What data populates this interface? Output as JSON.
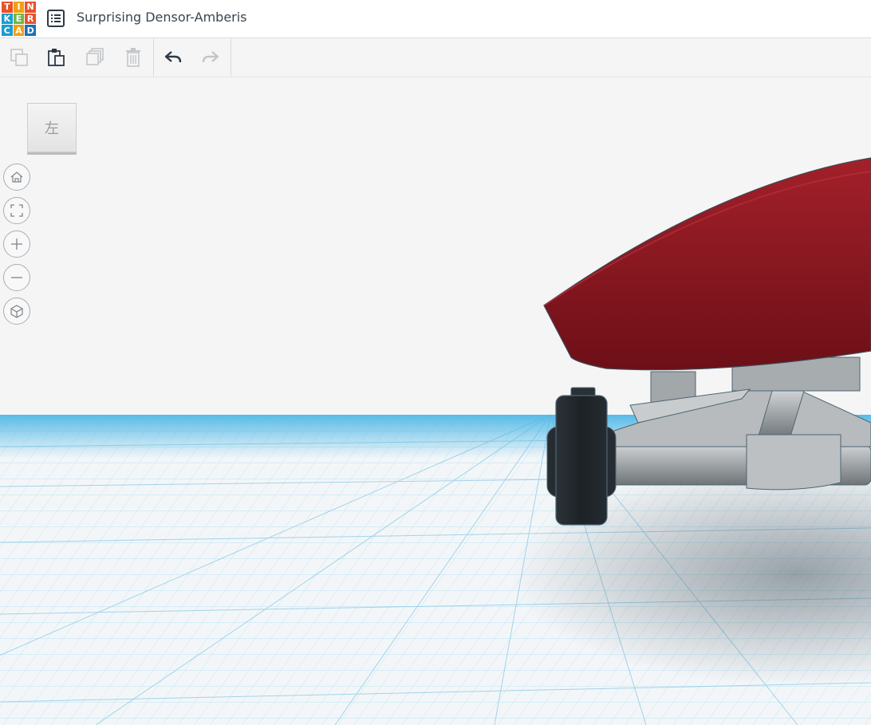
{
  "logo": {
    "letters": [
      "T",
      "I",
      "N",
      "K",
      "E",
      "R",
      "C",
      "A",
      "D"
    ],
    "colors": [
      "#e8522b",
      "#f0a014",
      "#e8522b",
      "#1d9bd1",
      "#6fb64b",
      "#e8522b",
      "#1d9bd1",
      "#f0a014",
      "#1d6fb8"
    ]
  },
  "header": {
    "design_name": "Surprising Densor-Amberis",
    "menu_icon": "list-icon"
  },
  "toolbar": {
    "buttons": [
      {
        "icon": "copy-icon",
        "enabled": false
      },
      {
        "icon": "paste-icon",
        "enabled": true
      },
      {
        "icon": "duplicate-icon",
        "enabled": false
      },
      {
        "icon": "delete-icon",
        "enabled": false
      },
      {
        "icon": "undo-icon",
        "enabled": true
      },
      {
        "icon": "redo-icon",
        "enabled": false
      }
    ]
  },
  "view_cube": {
    "face_label": "左"
  },
  "view_controls": [
    "home-icon",
    "fit-all-icon",
    "zoom-in-icon",
    "zoom-out-icon",
    "perspective-icon"
  ],
  "colors": {
    "board": "#8e1a22",
    "wheel": "#1e2428",
    "truck": "#9aa0a4",
    "grid": "#4fb8e6"
  }
}
